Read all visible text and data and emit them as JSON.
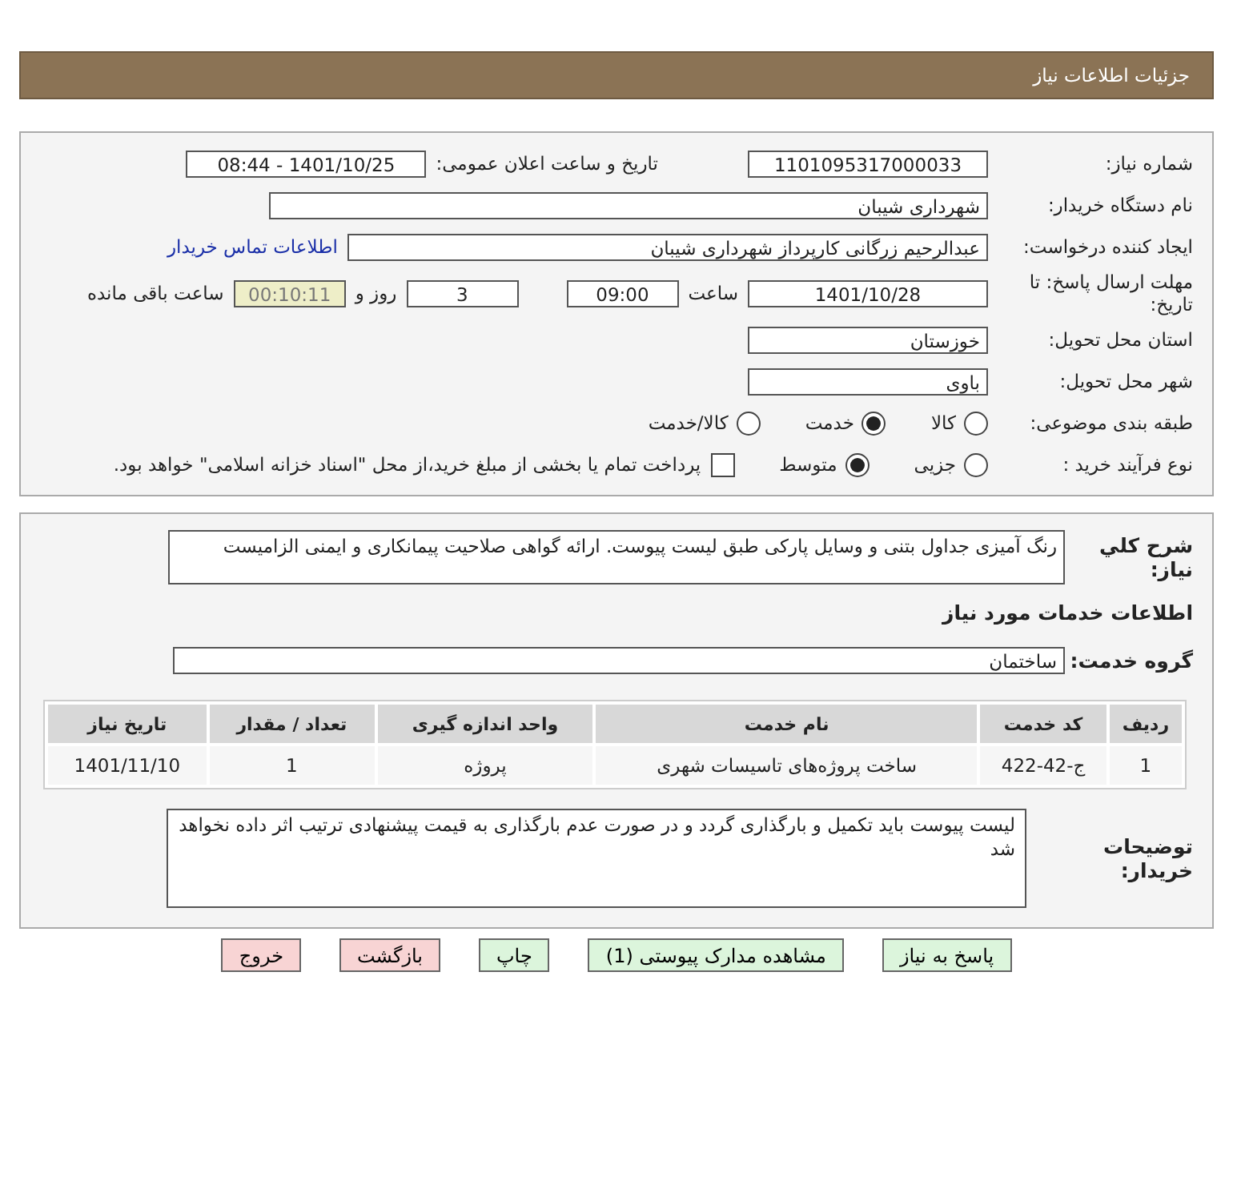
{
  "header": {
    "title": "جزئیات اطلاعات نیاز"
  },
  "need_number": {
    "label": "شماره نیاز:",
    "value": "1101095317000033"
  },
  "announce": {
    "label": "تاریخ و ساعت اعلان عمومی:",
    "value": "1401/10/25 - 08:44"
  },
  "buyer": {
    "label": "نام دستگاه خریدار:",
    "value": "شهرداری شیبان"
  },
  "creator": {
    "label": "ایجاد کننده درخواست:",
    "value": "عبدالرحیم زرگانی کارپرداز شهرداری شیبان",
    "link": "اطلاعات تماس خریدار"
  },
  "deadline": {
    "label": "مهلت ارسال پاسخ: تا تاریخ:",
    "date": "1401/10/28",
    "time_label": "ساعت",
    "time": "09:00",
    "days": "3",
    "days_label": "روز و",
    "remaining": "00:10:11",
    "remaining_label": "ساعت باقی مانده"
  },
  "province": {
    "label": "استان محل تحویل:",
    "value": "خوزستان"
  },
  "city": {
    "label": "شهر محل تحویل:",
    "value": "باوی"
  },
  "category": {
    "label": "طبقه بندی موضوعی:",
    "options": [
      {
        "label": "کالا",
        "selected": false
      },
      {
        "label": "خدمت",
        "selected": true
      },
      {
        "label": "کالا/خدمت",
        "selected": false
      }
    ]
  },
  "process": {
    "label": "نوع فرآیند خرید :",
    "options": [
      {
        "label": "جزیی",
        "selected": false
      },
      {
        "label": "متوسط",
        "selected": true
      }
    ],
    "payment": {
      "label": "پرداخت تمام یا بخشی از مبلغ خرید،از محل \"اسناد خزانه اسلامی\" خواهد بود.",
      "checked": false
    }
  },
  "description": {
    "label": "شرح کلي نیاز:",
    "value": "رنگ آمیزی جداول بتنی و وسایل پارکی طبق لیست پیوست. ارائه گواهی صلاحیت پیمانکاری و ایمنی الزامیست"
  },
  "services_heading": "اطلاعات خدمات مورد نیاز",
  "service_group": {
    "label": "گروه خدمت:",
    "value": "ساختمان"
  },
  "table": {
    "columns": [
      "ردیف",
      "کد خدمت",
      "نام خدمت",
      "واحد اندازه گیری",
      "تعداد / مقدار",
      "تاریخ نیاز"
    ],
    "rows": [
      [
        "1",
        "ج-42-422",
        "ساخت پروژه‌های تاسیسات شهری",
        "پروژه",
        "1",
        "1401/11/10"
      ]
    ]
  },
  "notes": {
    "label": "توضیحات خریدار:",
    "value": "لیست پیوست باید تکمیل و بارگذاری گردد و در صورت عدم بارگذاری به قیمت پیشنهادی ترتیب اثر داده نخواهد شد"
  },
  "buttons": [
    {
      "label": "پاسخ به نیاز",
      "kind": "normal"
    },
    {
      "label": "مشاهده مدارک پیوستی (1)",
      "kind": "normal"
    },
    {
      "label": "چاپ",
      "kind": "normal"
    },
    {
      "label": "بازگشت",
      "kind": "danger"
    },
    {
      "label": "خروج",
      "kind": "danger"
    }
  ]
}
